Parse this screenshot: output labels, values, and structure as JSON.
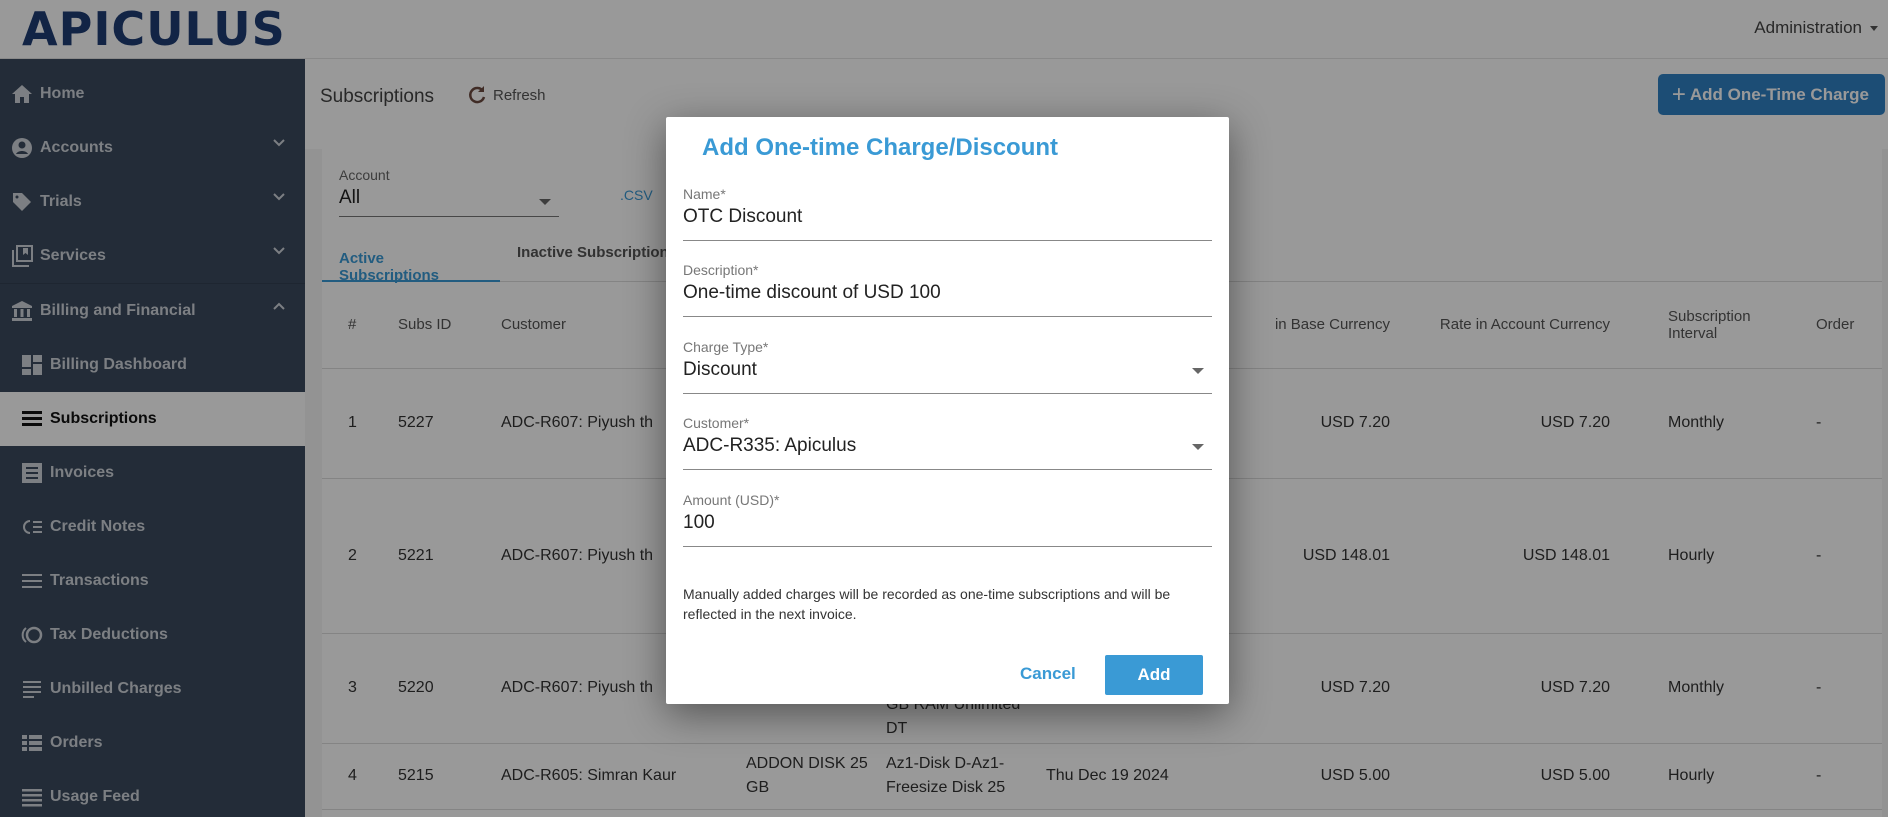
{
  "brand": {
    "logo_text": "APICULUS"
  },
  "topbar": {
    "admin_menu": "Administration"
  },
  "sidebar": {
    "items": [
      {
        "label": "Home",
        "icon": "home-icon"
      },
      {
        "label": "Accounts",
        "icon": "account-circle-icon",
        "expanded": false
      },
      {
        "label": "Trials",
        "icon": "tag-heart-icon",
        "expanded": false
      },
      {
        "label": "Services",
        "icon": "library-bookmark-icon",
        "expanded": false
      },
      {
        "label": "Billing and Financial",
        "icon": "bank-icon",
        "expanded": true
      },
      {
        "label": "Billing Dashboard",
        "icon": "dashboard-icon"
      },
      {
        "label": "Subscriptions",
        "icon": "list-icon",
        "active": true
      },
      {
        "label": "Invoices",
        "icon": "receipt-icon"
      },
      {
        "label": "Credit Notes",
        "icon": "credit-note-icon"
      },
      {
        "label": "Transactions",
        "icon": "menu-lines-icon"
      },
      {
        "label": "Tax Deductions",
        "icon": "tax-circle-icon"
      },
      {
        "label": "Unbilled Charges",
        "icon": "notes-lines-icon"
      },
      {
        "label": "Orders",
        "icon": "table-list-icon"
      },
      {
        "label": "Usage Feed",
        "icon": "lines-icon"
      }
    ]
  },
  "page": {
    "title": "Subscriptions",
    "refresh_label": "Refresh",
    "add_button_label": "Add One-Time Charge",
    "filter": {
      "label": "Account",
      "value": "All"
    },
    "csv_label": ".CSV",
    "tabs": [
      {
        "label": "Active Subscriptions",
        "active": true
      },
      {
        "label": "Inactive Subscriptions",
        "active": false
      }
    ]
  },
  "table": {
    "columns": [
      "#",
      "Subs ID",
      "Customer",
      "",
      "",
      "",
      "in Base Currency",
      "Rate in Account Currency",
      "Subscription Interval",
      "Order"
    ],
    "rows": [
      {
        "n": "1",
        "id": "5227",
        "customer": "ADC-R607: Piyush th",
        "plan": "",
        "item": "",
        "date": "",
        "base": "USD 7.20",
        "acct": "USD 7.20",
        "interval": "Monthly",
        "order": "-"
      },
      {
        "n": "2",
        "id": "5221",
        "customer": "ADC-R607: Piyush th",
        "plan": "",
        "item": "",
        "date": "",
        "base": "USD 148.01",
        "acct": "USD 148.01",
        "interval": "Hourly",
        "order": "-"
      },
      {
        "n": "3",
        "id": "5220",
        "customer": "ADC-R607: Piyush th",
        "plan": "",
        "item": "GB RAM Unlimited DT",
        "date": "",
        "base": "USD 7.20",
        "acct": "USD 7.20",
        "interval": "Monthly",
        "order": "-"
      },
      {
        "n": "4",
        "id": "5215",
        "customer": "ADC-R605: Simran Kaur",
        "plan": "ADDON DISK 25 GB",
        "item": "Az1-Disk D-Az1-Freesize Disk 25",
        "date": "Thu Dec 19 2024",
        "base": "USD 5.00",
        "acct": "USD 5.00",
        "interval": "Hourly",
        "order": "-"
      }
    ]
  },
  "modal": {
    "title": "Add One-time Charge/Discount",
    "fields": {
      "name": {
        "label": "Name*",
        "value": "OTC Discount"
      },
      "description": {
        "label": "Description*",
        "value": "One-time discount of USD 100"
      },
      "charge_type": {
        "label": "Charge Type*",
        "value": "Discount"
      },
      "customer": {
        "label": "Customer*",
        "value": "ADC-R335: Apiculus"
      },
      "amount": {
        "label": "Amount (USD)*",
        "value": "100"
      }
    },
    "note": "Manually added charges will be recorded as one-time subscriptions and will be reflected in the next invoice.",
    "cancel_label": "Cancel",
    "add_label": "Add"
  },
  "colors": {
    "accent": "#3a9ad5",
    "brand": "#1f3d73",
    "sidebar": "#3b4a5e",
    "primary_button": "#2f80c4"
  }
}
